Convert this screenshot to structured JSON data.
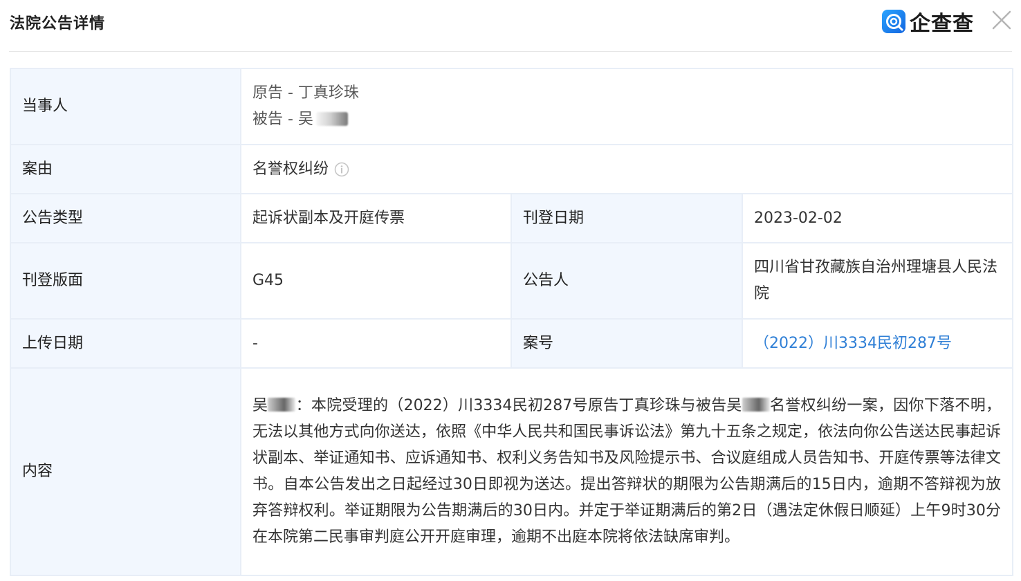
{
  "header": {
    "title": "法院公告详情",
    "brand": "企查查"
  },
  "details": {
    "party_label": "当事人",
    "plaintiff": "原告 - 丁真珍珠",
    "defendant": "被告 - 吴",
    "cause_label": "案由",
    "cause_value": "名誉权纠纷",
    "type_label": "公告类型",
    "type_value": "起诉状副本及开庭传票",
    "publish_date_label": "刊登日期",
    "publish_date_value": "2023-02-02",
    "page_label": "刊登版面",
    "page_value": "G45",
    "announcer_label": "公告人",
    "announcer_value": "四川省甘孜藏族自治州理塘县人民法院",
    "upload_date_label": "上传日期",
    "upload_date_value": "-",
    "case_no_label": "案号",
    "case_no_value": "（2022）川3334民初287号",
    "content_label": "内容",
    "content_part1": "吴",
    "content_part2": "：本院受理的（2022）川3334民初287号原告丁真珍珠与被告吴",
    "content_part3": "名誉权纠纷一案，因你下落不明，无法以其他方式向你送达，依照《中华人民共和国民事诉讼法》第九十五条之规定，依法向你公告送达民事起诉状副本、举证通知书、应诉通知书、权利义务告知书及风险提示书、合议庭组成人员告知书、开庭传票等法律文书。自本公告发出之日起经过30日即视为送达。提出答辩状的期限为公告期满后的15日内，逾期不答辩视为放弃答辩权利。举证期限为公告期满后的30日内。并定于举证期满后的第2日（遇法定休假日顺延）上午9时30分在本院第二民事审判庭公开开庭审理，逾期不出庭本院将依法缺席审判。"
  },
  "colors": {
    "label_bg": "#f2f7fe",
    "border": "#e8eef7",
    "link": "#2f7fd6",
    "brand_blue": "#1e88f0"
  }
}
